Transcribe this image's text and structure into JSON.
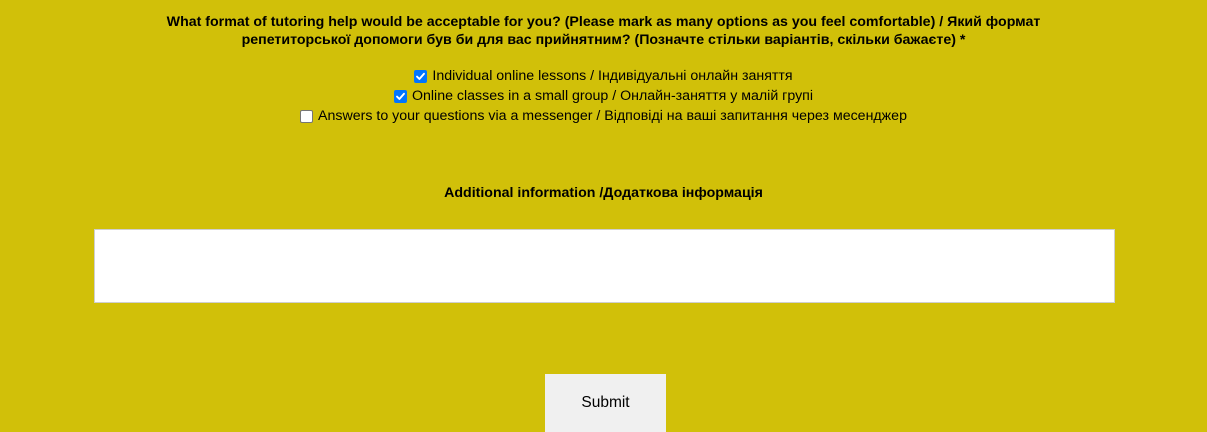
{
  "form": {
    "question_line1": "What format of tutoring help would be acceptable for you? (Please mark as many options as you feel comfortable) / Який формат",
    "question_line2": "репетиторської допомоги був би для вас прийнятним? (Позначте стільки варіантів, скільки бажаєте) *",
    "options": [
      {
        "label": "Individual online lessons / Індивідуальні онлайн заняття",
        "checked": true
      },
      {
        "label": "Online classes in a small group / Онлайн-заняття у малій групі",
        "checked": true
      },
      {
        "label": "Answers to your questions via a messenger / Відповіді на ваші запитання через месенджер",
        "checked": false
      }
    ],
    "additional_info_label": "Additional information /Додаткова інформація",
    "additional_info_value": "",
    "submit_label": "Submit"
  },
  "colors": {
    "background": "#d1c009",
    "checkbox_checked": "#0075ff",
    "button": "#f0f0f0"
  },
  "icons": {
    "checked": "checkmark-icon"
  }
}
